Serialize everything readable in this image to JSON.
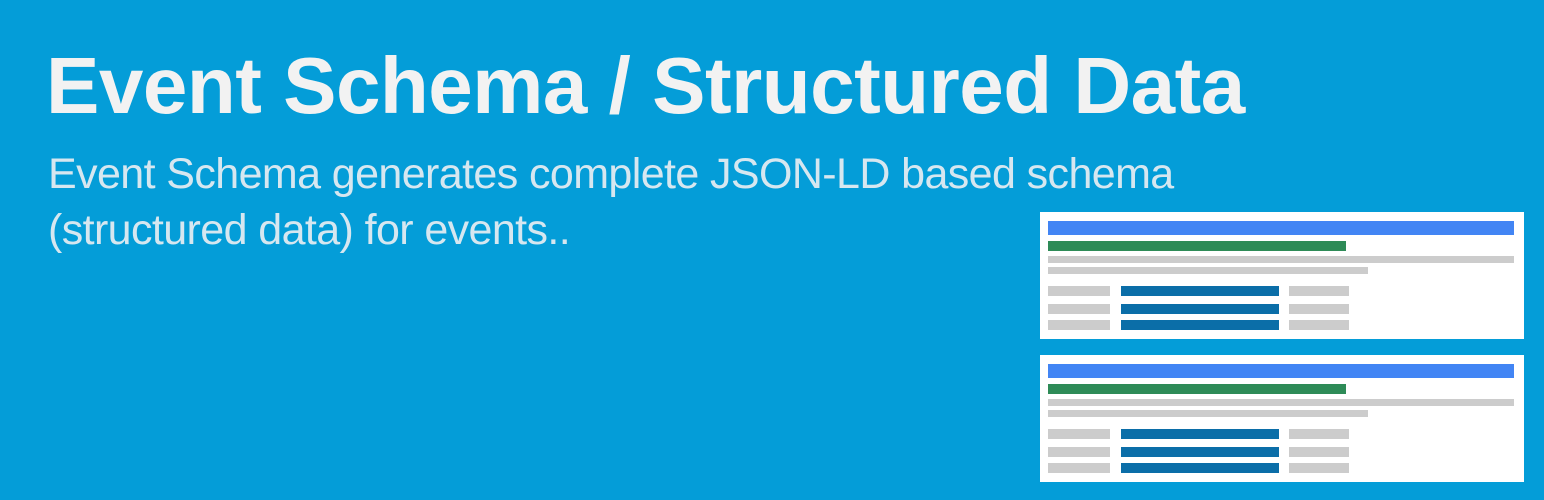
{
  "banner": {
    "title": "Event Schema / Structured Data",
    "subtitle": "Event Schema generates complete JSON-LD based schema (structured data) for events.."
  },
  "colors": {
    "background": "#049dd8",
    "title_text": "#f2f2f2",
    "subtitle_text": "#e8eef3",
    "card_background": "#ffffff",
    "result_title_bar": "#4285f4",
    "result_url_bar": "#2e8b57",
    "placeholder_gray": "#cccccc",
    "value_bar": "#0b6ea8"
  },
  "illustration": {
    "cards": [
      {
        "name": "search-result-card-1"
      },
      {
        "name": "search-result-card-2"
      }
    ]
  }
}
